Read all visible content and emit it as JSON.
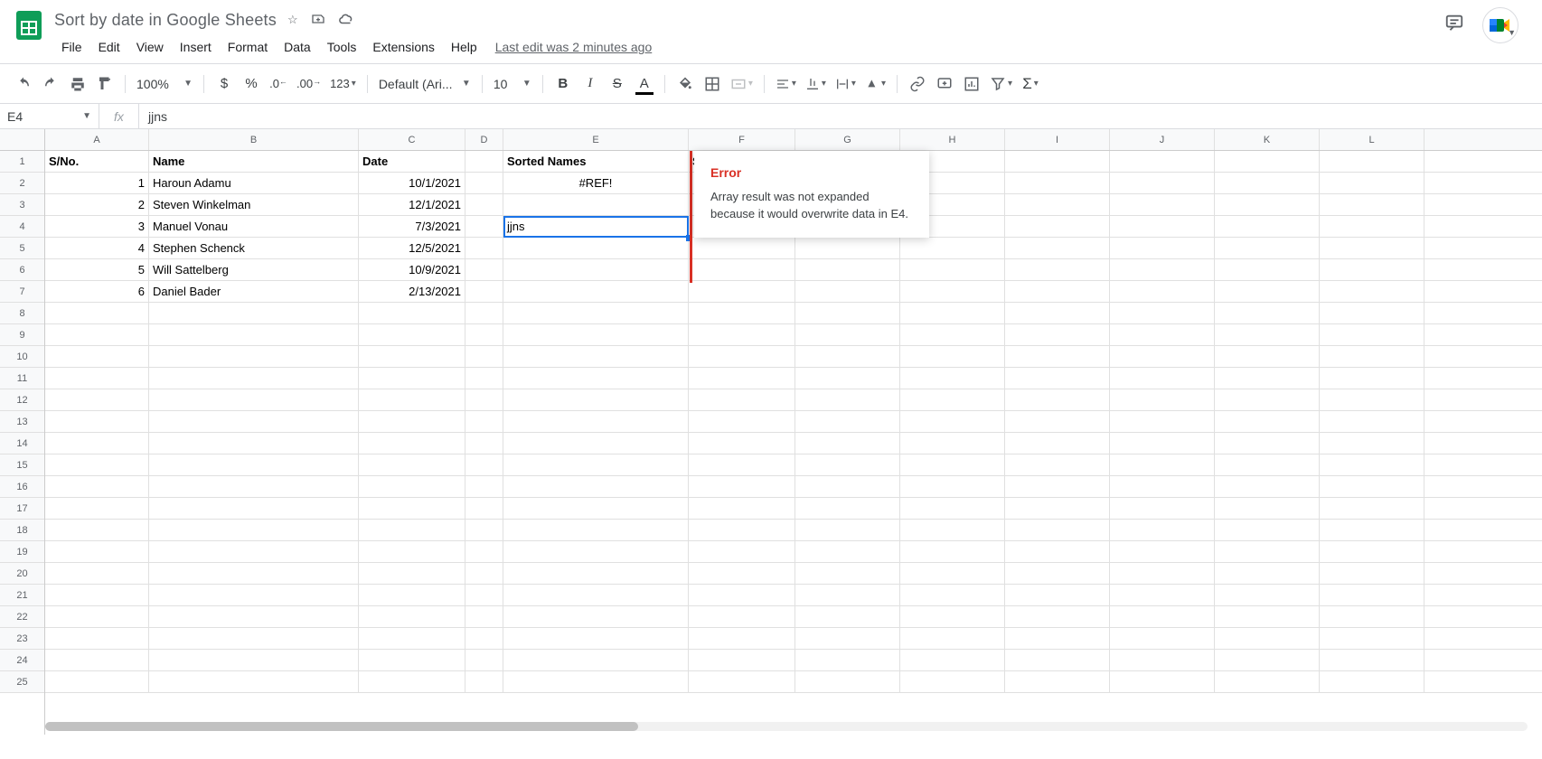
{
  "doc": {
    "title": "Sort by date in Google Sheets",
    "last_edit": "Last edit was 2 minutes ago"
  },
  "menus": [
    "File",
    "Edit",
    "View",
    "Insert",
    "Format",
    "Data",
    "Tools",
    "Extensions",
    "Help"
  ],
  "toolbar": {
    "zoom": "100%",
    "font": "Default (Ari...",
    "size": "10",
    "fmt123": "123"
  },
  "namebox": {
    "ref": "E4"
  },
  "formula": {
    "value": "jjns",
    "fx": "fx"
  },
  "columns": [
    "A",
    "B",
    "C",
    "D",
    "E",
    "F",
    "G",
    "H",
    "I",
    "J",
    "K",
    "L"
  ],
  "rows": [
    "1",
    "2",
    "3",
    "4",
    "5",
    "6",
    "7",
    "8",
    "9",
    "10",
    "11",
    "12",
    "13",
    "14",
    "15",
    "16",
    "17",
    "18",
    "19",
    "20",
    "21",
    "22",
    "23",
    "24",
    "25"
  ],
  "cells": {
    "headers": {
      "sno": "S/No.",
      "name": "Name",
      "date": "Date",
      "sorted_names": "Sorted Names",
      "sorted_dates": "Sorted Dates"
    },
    "data": [
      {
        "sno": "1",
        "name": "Haroun Adamu",
        "date": "10/1/2021"
      },
      {
        "sno": "2",
        "name": "Steven Winkelman",
        "date": "12/1/2021"
      },
      {
        "sno": "3",
        "name": "Manuel Vonau",
        "date": "7/3/2021"
      },
      {
        "sno": "4",
        "name": "Stephen Schenck",
        "date": "12/5/2021"
      },
      {
        "sno": "5",
        "name": "Will Sattelberg",
        "date": "10/9/2021"
      },
      {
        "sno": "6",
        "name": "Daniel Bader",
        "date": "2/13/2021"
      }
    ],
    "e2": "#REF!",
    "e4": "jjns"
  },
  "error": {
    "title": "Error",
    "message": "Array result was not expanded because it would overwrite data in E4."
  }
}
